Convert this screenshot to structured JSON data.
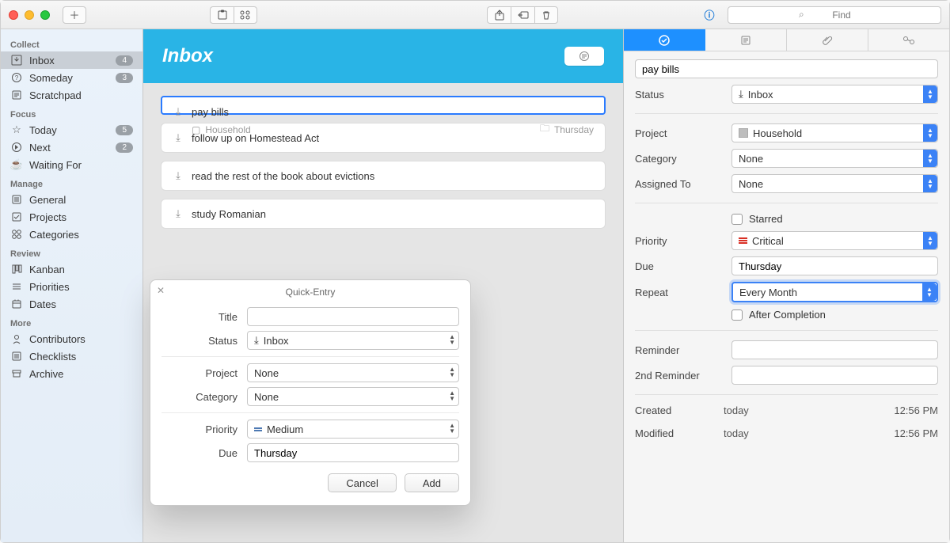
{
  "toolbar": {
    "search_placeholder": "Find"
  },
  "sidebar": {
    "sections": {
      "collect": {
        "heading": "Collect",
        "items": [
          {
            "label": "Inbox",
            "badge": "4"
          },
          {
            "label": "Someday",
            "badge": "3"
          },
          {
            "label": "Scratchpad"
          }
        ]
      },
      "focus": {
        "heading": "Focus",
        "items": [
          {
            "label": "Today",
            "badge": "5"
          },
          {
            "label": "Next",
            "badge": "2"
          },
          {
            "label": "Waiting For"
          }
        ]
      },
      "manage": {
        "heading": "Manage",
        "items": [
          {
            "label": "General"
          },
          {
            "label": "Projects"
          },
          {
            "label": "Categories"
          }
        ]
      },
      "review": {
        "heading": "Review",
        "items": [
          {
            "label": "Kanban"
          },
          {
            "label": "Priorities"
          },
          {
            "label": "Dates"
          }
        ]
      },
      "more": {
        "heading": "More",
        "items": [
          {
            "label": "Contributors"
          },
          {
            "label": "Checklists"
          },
          {
            "label": "Archive"
          }
        ]
      }
    }
  },
  "main": {
    "title": "Inbox",
    "tasks": [
      {
        "title": "pay bills",
        "project": "Household",
        "due": "Thursday"
      },
      {
        "title": "follow up on Homestead Act"
      },
      {
        "title": "read the rest of the book about evictions"
      },
      {
        "title": "study Romanian"
      }
    ]
  },
  "inspector": {
    "title": "pay bills",
    "status_label": "Status",
    "status_value": "Inbox",
    "project_label": "Project",
    "project_value": "Household",
    "category_label": "Category",
    "category_value": "None",
    "assigned_label": "Assigned To",
    "assigned_value": "None",
    "starred_label": "Starred",
    "priority_label": "Priority",
    "priority_value": "Critical",
    "due_label": "Due",
    "due_value": "Thursday",
    "repeat_label": "Repeat",
    "repeat_value": "Every Month",
    "after_completion_label": "After Completion",
    "reminder_label": "Reminder",
    "reminder_value": "",
    "second_reminder_label": "2nd Reminder",
    "second_reminder_value": "",
    "created_label": "Created",
    "created_value": "today",
    "created_time": "12:56 PM",
    "modified_label": "Modified",
    "modified_value": "today",
    "modified_time": "12:56 PM"
  },
  "quick_entry": {
    "window_title": "Quick-Entry",
    "title_label": "Title",
    "title_value": "",
    "status_label": "Status",
    "status_value": "Inbox",
    "project_label": "Project",
    "project_value": "None",
    "category_label": "Category",
    "category_value": "None",
    "priority_label": "Priority",
    "priority_value": "Medium",
    "due_label": "Due",
    "due_value": "Thursday",
    "cancel": "Cancel",
    "add": "Add"
  }
}
